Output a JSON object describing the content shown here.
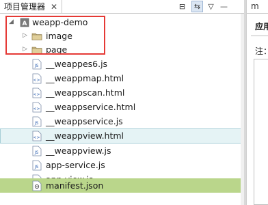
{
  "explorer": {
    "tab_label": "项目管理器",
    "close_glyph": "✕",
    "toolbar": {
      "collapse_glyph": "⊟",
      "link_glyph": "⇆",
      "menu_glyph": "▽",
      "minimize_glyph": "—"
    },
    "tree": {
      "root": {
        "label": "weapp-demo",
        "expanded": true
      },
      "folders": [
        {
          "label": "image",
          "expanded": false
        },
        {
          "label": "page",
          "expanded": false
        }
      ],
      "files": [
        {
          "label": "__weappes6.js",
          "type": "js"
        },
        {
          "label": "__weappmap.html",
          "type": "html"
        },
        {
          "label": "__weappscan.html",
          "type": "html"
        },
        {
          "label": "__weappservice.html",
          "type": "html"
        },
        {
          "label": "__weappservice.js",
          "type": "js"
        },
        {
          "label": "__weappview.html",
          "type": "html",
          "state": "hover"
        },
        {
          "label": "__weappview.js",
          "type": "js"
        },
        {
          "label": "app-service.js",
          "type": "js"
        },
        {
          "label": "app-view.js",
          "type": "js"
        },
        {
          "label": "manifest.json",
          "type": "json",
          "state": "selected"
        }
      ]
    }
  },
  "right_panel": {
    "tab_label": "m",
    "title": "应用",
    "note": "注："
  },
  "colors": {
    "highlight_box": "#e53935",
    "selected_row": "#bad68b",
    "hover_row": "#e5f3f5"
  }
}
